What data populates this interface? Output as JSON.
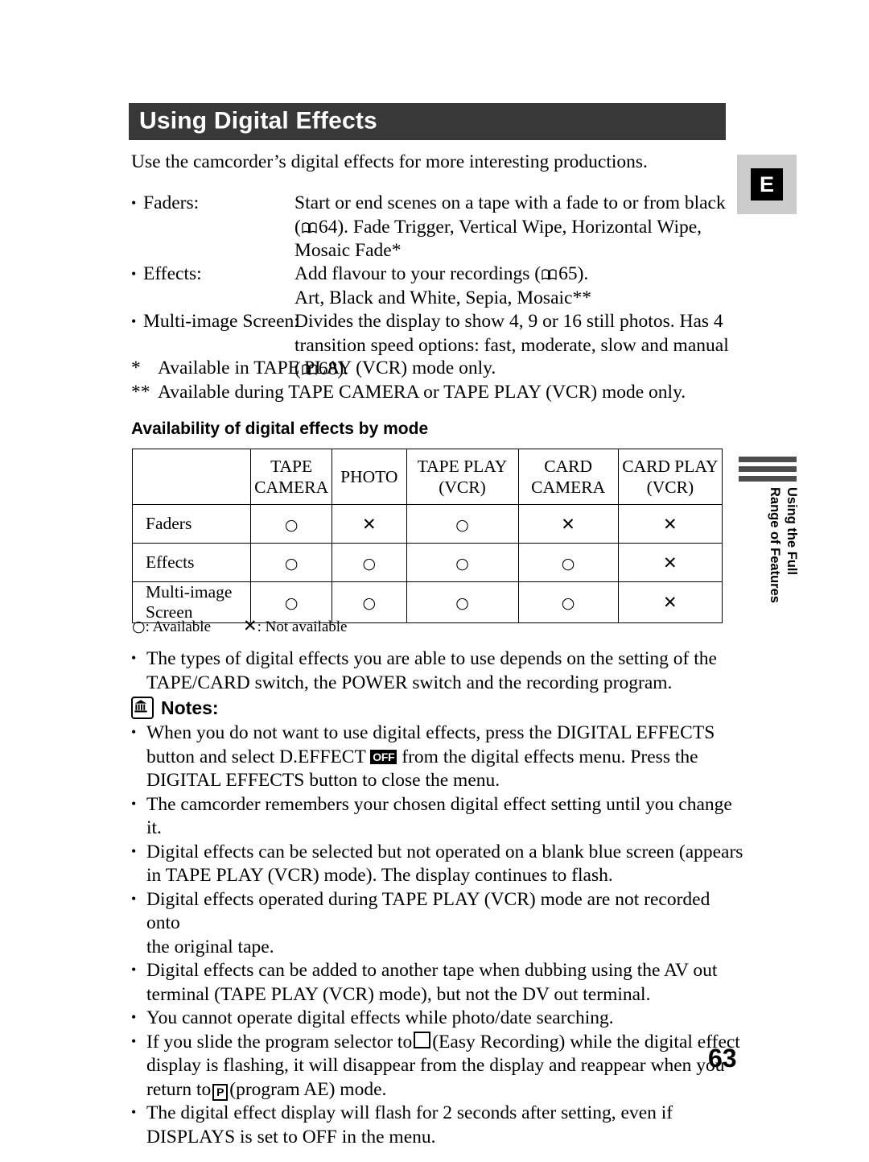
{
  "header": {
    "title": "Using Digital Effects"
  },
  "margin": {
    "edition_tab": "E",
    "section_tab_text": "Using the Full\nRange of Features"
  },
  "intro": "Use the camcorder’s digital effects for more interesting productions.",
  "definitions": [
    {
      "term": "Faders:",
      "lines": [
        "Start or end scenes on a tape with a fade to or from black",
        "( 64). Fade Trigger, Vertical Wipe, Horizontal Wipe,",
        "Mosaic Fade*"
      ],
      "ref_line_index": 1,
      "ref_page": "64"
    },
    {
      "term": "Effects:",
      "lines": [
        "Add flavour to your recordings ( 65).",
        "Art, Black and White, Sepia, Mosaic**"
      ],
      "ref_line_index": 0,
      "ref_page": "65"
    },
    {
      "term": "Multi-image Screen:",
      "lines": [
        "Divides the display to show 4, 9 or 16 still photos. Has 4",
        "transition speed options: fast, moderate, slow and manual",
        "( 68)."
      ],
      "ref_line_index": 2,
      "ref_page": "68"
    }
  ],
  "def_text": {
    "faders_term": "Faders:",
    "faders_l1": "Start or end scenes on a tape with a fade to or from black",
    "faders_l2a": "(",
    "faders_l2b": "64). Fade Trigger, Vertical Wipe, Horizontal Wipe,",
    "faders_l3": "Mosaic Fade*",
    "effects_term": "Effects:",
    "effects_l1a": "Add flavour to your recordings (",
    "effects_l1b": "65).",
    "effects_l2": "Art, Black and White, Sepia, Mosaic**",
    "multi_term": "Multi-image Screen:",
    "multi_l1": "Divides the display to show 4, 9 or 16 still photos. Has 4",
    "multi_l2": "transition speed options: fast, moderate, slow and manual",
    "multi_l3a": "(",
    "multi_l3b": "68)."
  },
  "footnotes": [
    {
      "mark": "*",
      "text": "Available in TAPE PLAY (VCR) mode only."
    },
    {
      "mark": "**",
      "text": "Available during TAPE CAMERA or TAPE PLAY (VCR) mode only."
    }
  ],
  "footnote_text": {
    "one_mark": "*",
    "one": "Available in TAPE PLAY (VCR) mode only.",
    "two_mark": "**",
    "two": "Available during TAPE CAMERA or TAPE PLAY (VCR) mode only."
  },
  "table": {
    "caption": "Availability of digital effects by mode",
    "columns": [
      "",
      "TAPE\nCAMERA",
      "PHOTO",
      "TAPE PLAY\n(VCR)",
      "CARD\nCAMERA",
      "CARD PLAY\n(VCR)"
    ],
    "column_lines": {
      "c1a": "TAPE",
      "c1b": "CAMERA",
      "c2a": "PHOTO",
      "c2b": "",
      "c3a": "TAPE PLAY",
      "c3b": "(VCR)",
      "c4a": "CARD",
      "c4b": "CAMERA",
      "c5a": "CARD PLAY",
      "c5b": "(VCR)"
    },
    "rows": [
      {
        "label": "Faders",
        "label_l1": "Faders",
        "label_l2": "",
        "values": [
          "○",
          "✕",
          "○",
          "✕",
          "✕"
        ]
      },
      {
        "label": "Effects",
        "label_l1": "Effects",
        "label_l2": "",
        "values": [
          "○",
          "○",
          "○",
          "○",
          "✕"
        ]
      },
      {
        "label": "Multi-image Screen",
        "label_l1": "Multi-image",
        "label_l2": "Screen",
        "values": [
          "○",
          "○",
          "○",
          "○",
          "✕"
        ]
      }
    ],
    "legend": {
      "available_symbol": "○",
      "available_text": ": Available",
      "not_available_symbol": "✕",
      "not_available_text": ": Not available"
    }
  },
  "bullets_top": {
    "b1_l1": "The types of digital effects you are able to use depends on the setting of the",
    "b1_l2": "TAPE/CARD switch, the POWER switch and the recording program."
  },
  "notes": {
    "heading": "Notes:",
    "items": {
      "n1_l1": "When you do not want to use digital effects, press the DIGITAL EFFECTS",
      "n1_l2a": "button and select D.EFFECT",
      "n1_off": "OFF",
      "n1_l2b": "from the digital effects menu. Press the",
      "n1_l3": "DIGITAL EFFECTS button to close the menu.",
      "n2": "The camcorder remembers your chosen digital effect setting until you change it.",
      "n3_l1": "Digital effects can be selected but not operated on a blank blue screen (appears",
      "n3_l2": "in TAPE PLAY (VCR) mode). The display continues to flash.",
      "n4_l1": "Digital effects operated during TAPE PLAY (VCR) mode are not recorded onto",
      "n4_l2": "the original tape.",
      "n5_l1": "Digital effects can be added to another tape when dubbing using the AV out",
      "n5_l2": "terminal (TAPE PLAY (VCR) mode), but not the DV out terminal.",
      "n6": "You cannot operate digital effects while photo/date searching.",
      "n7_l1a": "If you slide the program selector to",
      "n7_l1b": "(Easy Recording) while the digital effect",
      "n7_l2": "display is flashing, it will disappear from the display and reappear when you",
      "n7_l3a": "return to",
      "n7_l3b": "(program AE) mode.",
      "n8_l1": "The digital effect display will flash for 2 seconds after setting, even if",
      "n8_l2": "DISPLAYS is set to OFF in the menu."
    }
  },
  "page_number": "63",
  "colors": {
    "header_bar": "#383838",
    "tab_background": "#cccccc",
    "tab_block": "#000000",
    "side_bars": "#4d4d4d",
    "text": "#000000"
  }
}
